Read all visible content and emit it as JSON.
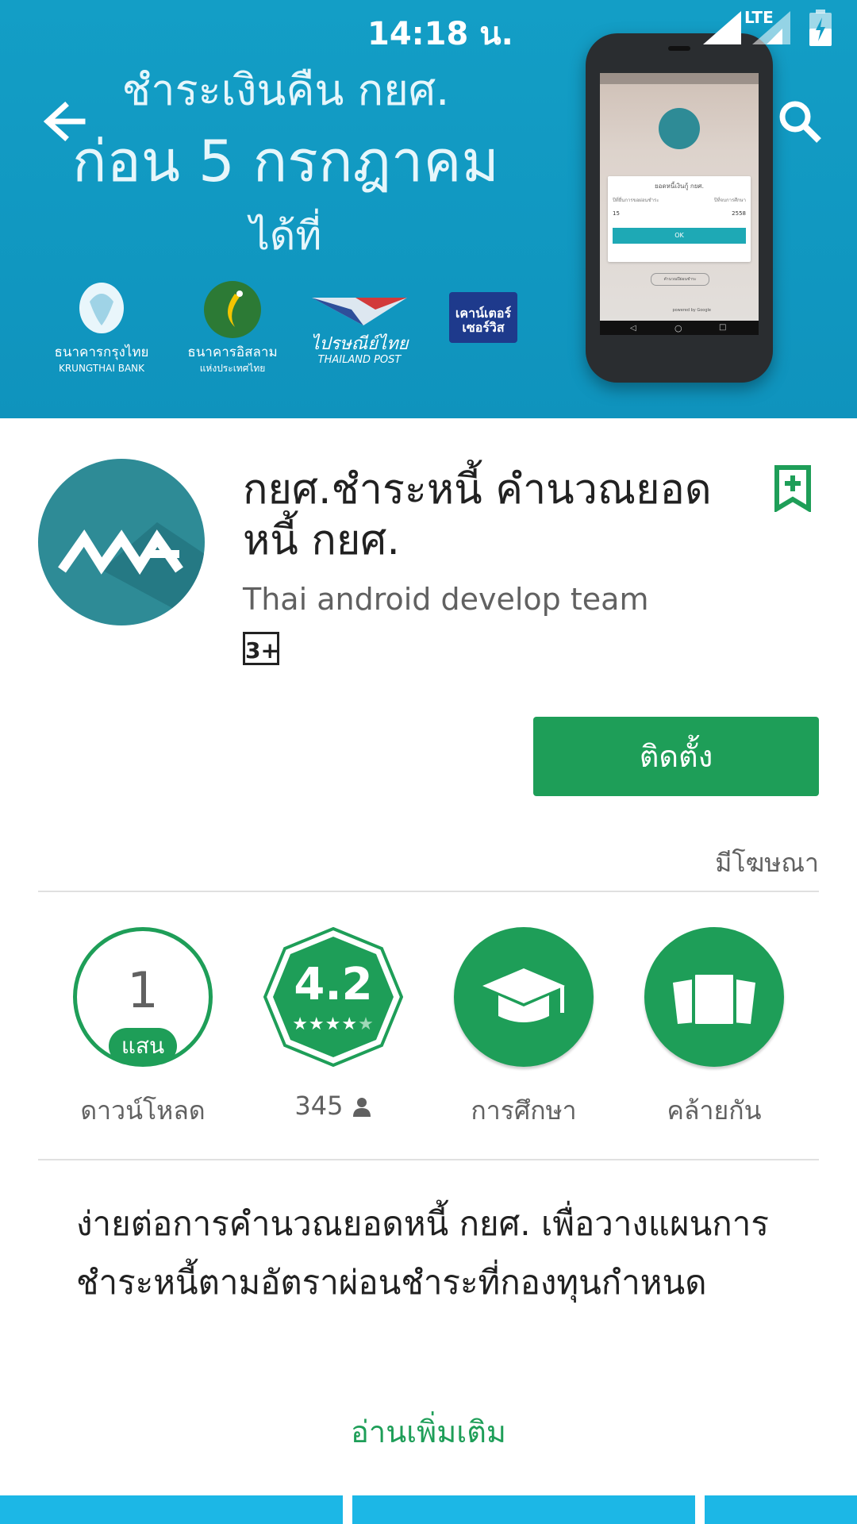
{
  "status_bar": {
    "time": "14:18 น.",
    "network": "LTE"
  },
  "banner": {
    "line1": "ชำระเงินคืน กยศ.",
    "line2": "ก่อน 5 กรกฎาคม",
    "line3": "ได้ที่",
    "logos": [
      {
        "name": "ธนาคารกรุงไทย",
        "sub": "KRUNGTHAI BANK"
      },
      {
        "name": "ธนาคารอิสลาม",
        "sub": "แห่งประเทศไทย"
      },
      {
        "name": "ไปรษณีย์ไทย",
        "sub": "THAILAND POST"
      },
      {
        "name": "เคาน์เตอร์ เซอร์วิส",
        "sub": ""
      }
    ],
    "phone": {
      "field_title": "ยอดหนี้เงินกู้ กยศ.",
      "label_year_borrow": "ปีที่ยื่นการขอผ่อนชำระ",
      "label_year_study": "ปีที่จบการศึกษา",
      "value_year_borrow": "15",
      "value_year_study": "2558",
      "ok": "OK",
      "secondary": "คำนวณปีผ่อนชำระ",
      "powered": "powered by Google"
    }
  },
  "app": {
    "title": "กยศ.ชำระหนี้ คำนวณยอดหนี้ กยศ.",
    "developer": "Thai android develop team",
    "content_rating": "3+",
    "install_label": "ติดตั้ง",
    "ads_label": "มีโฆษณา"
  },
  "stats": {
    "downloads": {
      "value": "1",
      "unit": "แสน",
      "label": "ดาวน์โหลด"
    },
    "rating": {
      "value": "4.2",
      "stars": 4.2,
      "count": "345"
    },
    "category": {
      "label": "การศึกษา"
    },
    "similar": {
      "label": "คล้ายกัน"
    }
  },
  "description": "ง่ายต่อการคำนวณยอดหนี้ กยศ. เพื่อวางแผนการชำระหนี้ตามอัตราผ่อนชำระที่กองทุนกำหนด",
  "read_more": "อ่านเพิ่มเติม",
  "colors": {
    "accent": "#1e9e58",
    "banner": "#139ec6",
    "app_icon": "#2e8b96",
    "screenshot": "#1cb7e6"
  }
}
